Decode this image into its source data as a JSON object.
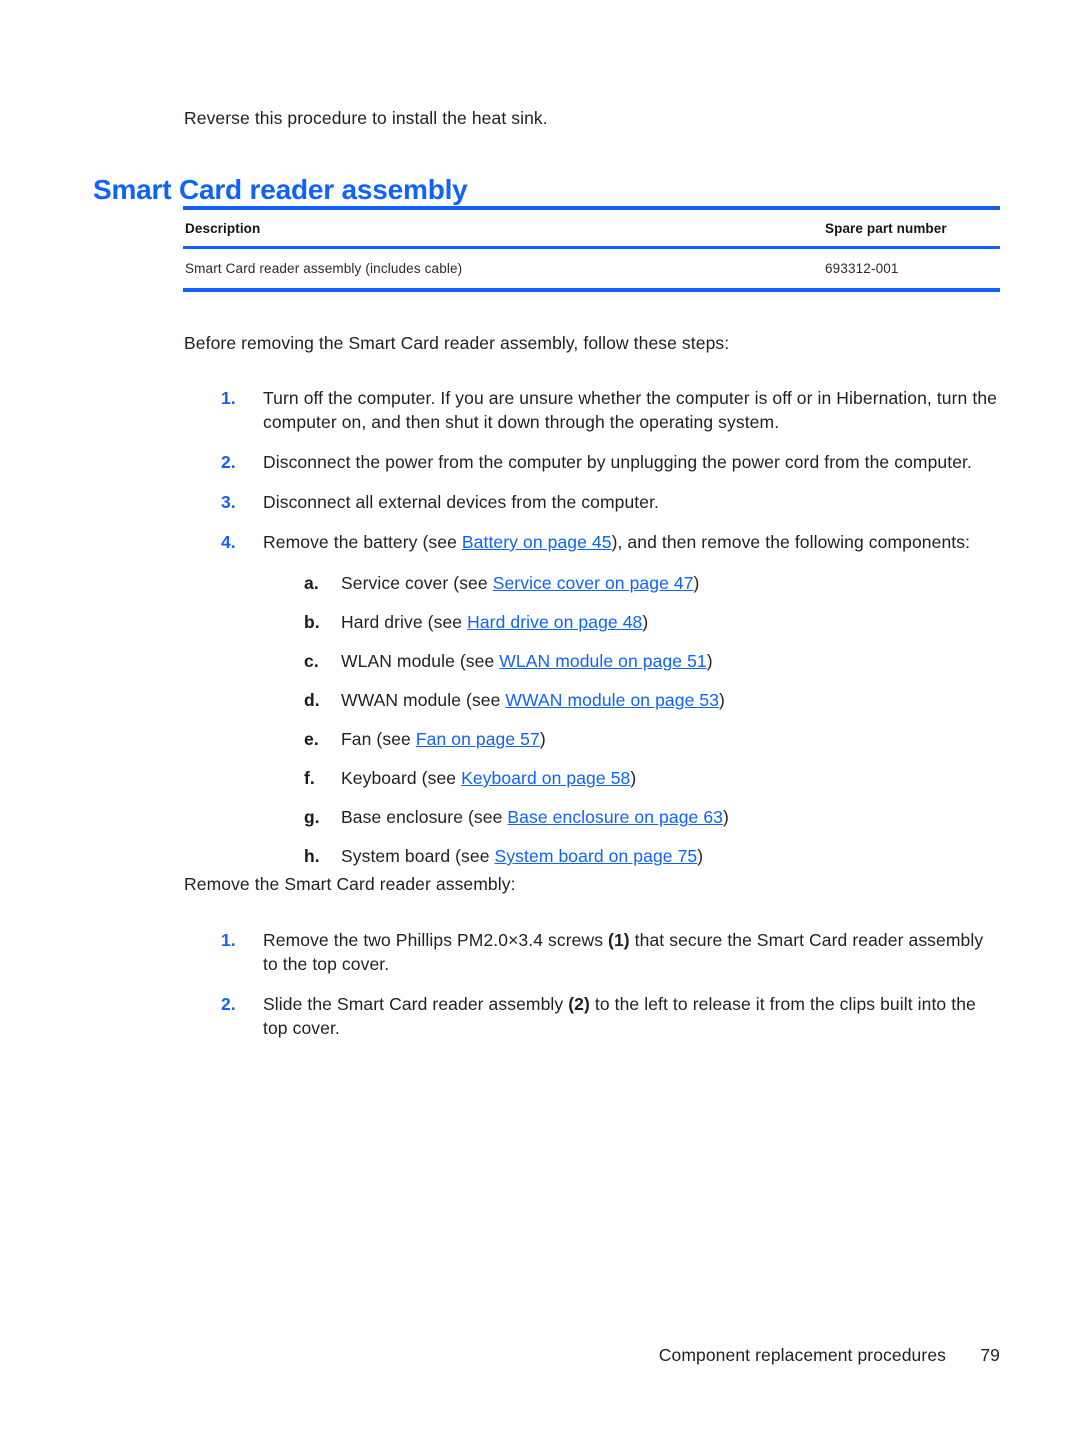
{
  "document": {
    "intro_line": "Reverse this procedure to install the heat sink.",
    "section_heading": "Smart Card reader assembly"
  },
  "parts_table": {
    "columns": [
      "Description",
      "Spare part number"
    ],
    "rows": [
      {
        "description": "Smart Card reader assembly (includes cable)",
        "spare_part_number": "693312-001"
      }
    ],
    "rule_color": "#0f62fe"
  },
  "prep": {
    "lead_in": "Before removing the Smart Card reader assembly, follow these steps:",
    "steps": [
      {
        "marker": "1.",
        "text": "Turn off the computer. If you are unsure whether the computer is off or in Hibernation, turn the computer on, and then shut it down through the operating system."
      },
      {
        "marker": "2.",
        "text": "Disconnect the power from the computer by unplugging the power cord from the computer."
      },
      {
        "marker": "3.",
        "text": "Disconnect all external devices from the computer."
      },
      {
        "marker": "4.",
        "text_before": "Remove the battery (see ",
        "link": "Battery on page 45",
        "text_after": "), and then remove the following components:",
        "sub_steps": [
          {
            "marker": "a.",
            "text_before": "Service cover (see ",
            "link": "Service cover on page 47",
            "text_after": ")"
          },
          {
            "marker": "b.",
            "text_before": "Hard drive (see ",
            "link": "Hard drive on page 48",
            "text_after": ")"
          },
          {
            "marker": "c.",
            "text_before": "WLAN module (see ",
            "link": "WLAN module on page 51",
            "text_after": ")"
          },
          {
            "marker": "d.",
            "text_before": "WWAN module (see ",
            "link": "WWAN module on page 53",
            "text_after": ")"
          },
          {
            "marker": "e.",
            "text_before": "Fan (see ",
            "link": "Fan on page 57",
            "text_after": ")"
          },
          {
            "marker": "f.",
            "text_before": "Keyboard (see ",
            "link": "Keyboard on page 58",
            "text_after": ")"
          },
          {
            "marker": "g.",
            "text_before": "Base enclosure (see ",
            "link": "Base enclosure on page 63",
            "text_after": ")"
          },
          {
            "marker": "h.",
            "text_before": "System board (see ",
            "link": "System board on page 75",
            "text_after": ")"
          }
        ]
      }
    ]
  },
  "removal": {
    "lead_in": "Remove the Smart Card reader assembly:",
    "steps": [
      {
        "marker": "1.",
        "part_a": "Remove the two Phillips PM2.0×3.4 screws ",
        "callout": "(1)",
        "part_b": " that secure the Smart Card reader assembly to the top cover."
      },
      {
        "marker": "2.",
        "part_a": "Slide the Smart Card reader assembly ",
        "callout": "(2)",
        "part_b": " to the left to release it from the clips built into the top cover."
      }
    ]
  },
  "footer": {
    "title": "Component replacement procedures",
    "page_number": "79"
  },
  "colors": {
    "accent_blue": "#0f62fe",
    "body_text": "#231f20",
    "page_background": "#ffffff"
  }
}
